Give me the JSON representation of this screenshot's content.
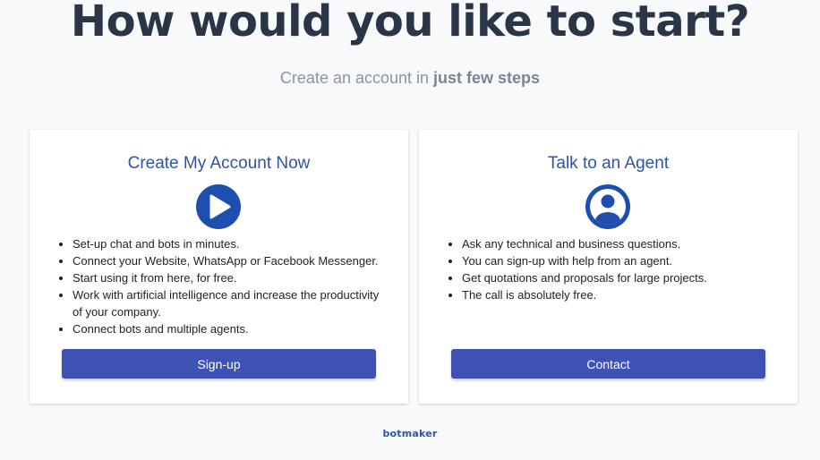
{
  "header": {
    "title": "How would you like to start?",
    "subtitle_prefix": "Create an account in ",
    "subtitle_emphasis": "just few steps"
  },
  "cards": [
    {
      "title": "Create My Account Now",
      "icon": "play-icon",
      "items": [
        "Set-up chat and bots in minutes.",
        "Connect your Website, WhatsApp or Facebook Messenger.",
        "Start using it from here, for free.",
        "Work with artificial intelligence and increase the productivity of your company.",
        "Connect bots and multiple agents."
      ],
      "button_label": "Sign-up"
    },
    {
      "title": "Talk to an Agent",
      "icon": "user-icon",
      "items": [
        "Ask any technical and business questions.",
        "You can sign-up with help from an agent.",
        "Get quotations and proposals for large projects.",
        "The call is absolutely free."
      ],
      "button_label": "Contact"
    }
  ],
  "footer": {
    "logo_text": "botmaker"
  },
  "colors": {
    "accent": "#3f51b5",
    "title_blue": "#2f54a8",
    "icon_blue": "#1e4fb0",
    "headline": "#2a3547",
    "background": "#f8f9fb"
  }
}
